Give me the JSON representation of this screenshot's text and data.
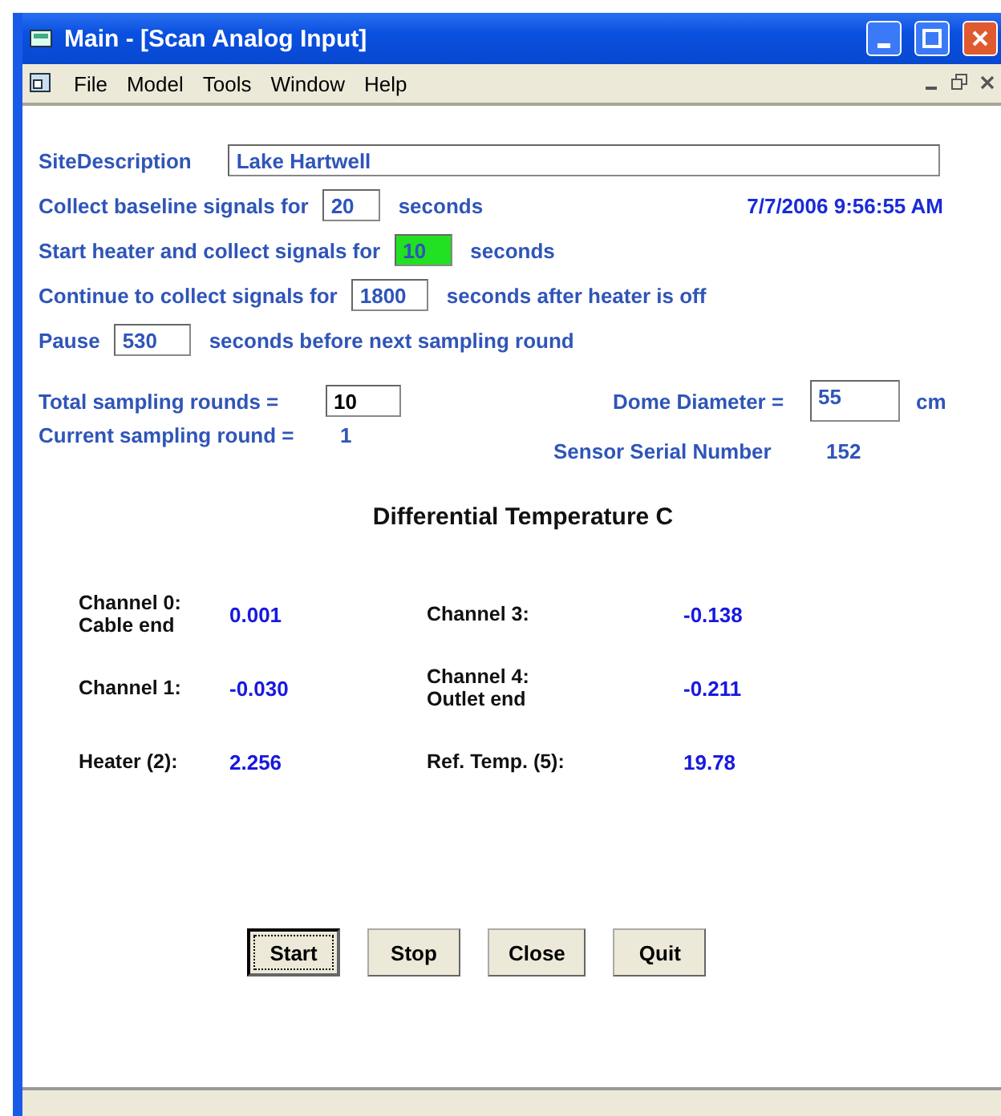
{
  "window": {
    "title": "Main - [Scan Analog Input]"
  },
  "menu": [
    "File",
    "Model",
    "Tools",
    "Window",
    "Help"
  ],
  "site": {
    "label": "SiteDescription",
    "value": "Lake Hartwell"
  },
  "timestamp": "7/7/2006 9:56:55 AM",
  "timing_rows": [
    {
      "before": "Collect baseline signals for",
      "value": "20",
      "after": "seconds",
      "highlighted": false
    },
    {
      "before": "Start heater and collect signals for",
      "value": "10",
      "after": "seconds",
      "highlighted": true
    },
    {
      "before": "Continue to collect signals for",
      "value": "1800",
      "after": "seconds after heater is off",
      "highlighted": false
    },
    {
      "before": "Pause",
      "value": "530",
      "after": "seconds before next sampling round",
      "highlighted": false
    }
  ],
  "total_rounds": {
    "label": "Total sampling rounds =",
    "value": "10"
  },
  "dome": {
    "label": "Dome Diameter =",
    "value": "55",
    "unit": "cm"
  },
  "current_round": {
    "label": "Current sampling round =",
    "value": "1"
  },
  "serial": {
    "label": "Sensor Serial Number",
    "value": "152"
  },
  "readings_title": "Differential Temperature C",
  "readings": [
    {
      "label": "Channel 0:\nCable end",
      "value": "0.001"
    },
    {
      "label": "Channel 3:",
      "value": "-0.138"
    },
    {
      "label": "Channel 1:",
      "value": "-0.030"
    },
    {
      "label": "Channel 4:\nOutlet end",
      "value": "-0.211"
    },
    {
      "label": "Heater (2):",
      "value": "2.256"
    },
    {
      "label": "Ref. Temp. (5):",
      "value": "19.78"
    }
  ],
  "buttons": [
    {
      "label": "Start",
      "default": true
    },
    {
      "label": "Stop",
      "default": false
    },
    {
      "label": "Close",
      "default": false
    },
    {
      "label": "Quit",
      "default": false
    }
  ]
}
